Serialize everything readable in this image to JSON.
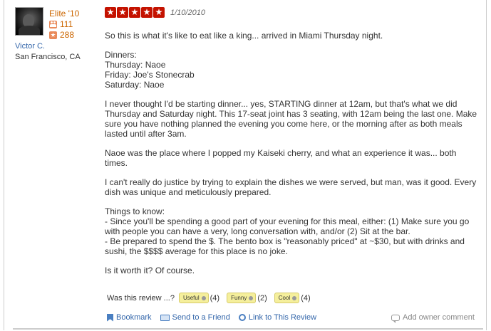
{
  "reviewer": {
    "elite": "Elite '10",
    "friends": "111",
    "reviews": "288",
    "name": "Victor C.",
    "location": "San Francisco, CA"
  },
  "review": {
    "rating": 5,
    "rating_max": 5,
    "date": "1/10/2010",
    "paragraphs": [
      "So this is what it's like to eat like a king... arrived in Miami Thursday night.",
      "Dinners:\nThursday: Naoe\nFriday: Joe's Stonecrab\nSaturday: Naoe",
      "I never thought I'd be starting dinner... yes, STARTING dinner at 12am, but that's what we did Thursday and Saturday night. This 17-seat joint has 3 seating, with 12am being the last one. Make sure you have nothing planned the evening you come here, or the morning after as both meals lasted until after 3am.",
      "Naoe was the place where I popped my Kaiseki cherry, and what an experience it was... both times.",
      "I can't really do justice by trying to explain the dishes we were served, but man, was it good. Every dish was unique and meticulously prepared.",
      "Things to know:\n- Since you'll be spending a good part of your evening for this meal, either: (1) Make sure you go with people you can have a very, long conversation with, and/or (2) Sit at the bar.\n- Be prepared to spend the $. The bento box is \"reasonably priced\" at ~$30, but with drinks and sushi, the $$$$ average for this place is no joke.",
      "Is it worth it? Of course."
    ]
  },
  "votes": {
    "prompt": "Was this review ...?",
    "useful_label": "Useful",
    "useful_count": "(4)",
    "funny_label": "Funny",
    "funny_count": "(2)",
    "cool_label": "Cool",
    "cool_count": "(4)"
  },
  "actions": {
    "bookmark": "Bookmark",
    "send_to_friend": "Send to a Friend",
    "link": "Link to This Review",
    "owner_comment": "Add owner comment"
  },
  "colors": {
    "star_red": "#c41200",
    "elite_orange": "#cc6600",
    "link_blue": "#3366aa",
    "vote_yellow": "#f5ef9c"
  }
}
